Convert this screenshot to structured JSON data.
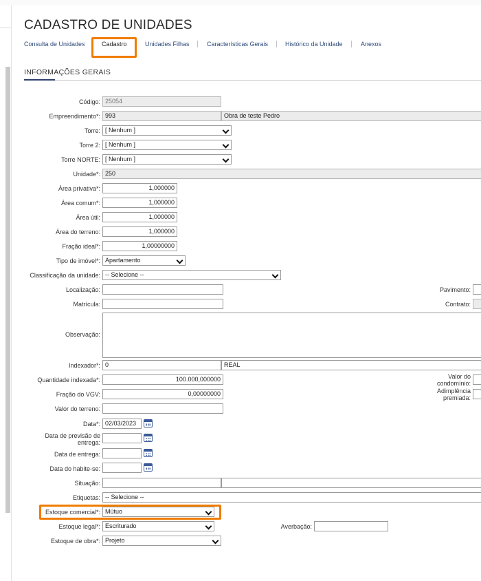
{
  "page": {
    "title": "CADASTRO DE UNIDADES"
  },
  "tabs": [
    {
      "label": "Consulta de Unidades"
    },
    {
      "label": "Cadastro"
    },
    {
      "label": "Unidades Filhas"
    },
    {
      "label": "Características Gerais"
    },
    {
      "label": "Histórico da Unidade"
    },
    {
      "label": "Anexos"
    }
  ],
  "section": {
    "title": "INFORMAÇÕES GERAIS"
  },
  "form": {
    "codigo": {
      "label": "Código:",
      "value": "25054"
    },
    "empreendimento": {
      "label": "Empreendimento*:",
      "code": "993",
      "name": "Obra de teste Pedro"
    },
    "torre": {
      "label": "Torre:",
      "value": "[ Nenhum ]"
    },
    "torre2": {
      "label": "Torre 2:",
      "value": "[ Nenhum ]"
    },
    "torre_norte": {
      "label": "Torre NORTE:",
      "value": "[ Nenhum ]"
    },
    "unidade": {
      "label": "Unidade*:",
      "value": "250"
    },
    "area_privativa": {
      "label": "Área privativa*:",
      "value": "1,000000"
    },
    "area_comum": {
      "label": "Área comum*:",
      "value": "1,000000"
    },
    "area_util": {
      "label": "Área útil:",
      "value": "1,000000"
    },
    "area_terreno": {
      "label": "Área do terreno:",
      "value": "1,000000"
    },
    "fracao_ideal": {
      "label": "Fração ideal*:",
      "value": "1,00000000"
    },
    "tipo_imovel": {
      "label": "Tipo de imóvel*:",
      "value": "Apartamento"
    },
    "classificacao": {
      "label": "Classificação da unidade:",
      "value": "-- Selecione --"
    },
    "localizacao": {
      "label": "Localização:",
      "value": ""
    },
    "pavimento": {
      "label": "Pavimento:",
      "value": ""
    },
    "matricula": {
      "label": "Matrícula:",
      "value": ""
    },
    "contrato": {
      "label": "Contrato:",
      "value": ""
    },
    "observacao": {
      "label": "Observação:",
      "value": ""
    },
    "indexador": {
      "label": "Indexador*:",
      "code": "0",
      "name": "REAL"
    },
    "quantidade_indexada": {
      "label": "Quantidade indexada*:",
      "value": "100.000,000000"
    },
    "valor_condominio": {
      "label_line1": "Valor do",
      "label_line2": "condomínio:",
      "value": ""
    },
    "fracao_vgv": {
      "label": "Fração do VGV:",
      "value": "0,00000000"
    },
    "adimplencia": {
      "label_line1": "Adimplência",
      "label_line2": "premiada:",
      "value": ""
    },
    "valor_terreno": {
      "label": "Valor do terreno:",
      "value": ""
    },
    "data": {
      "label": "Data*:",
      "value": "02/03/2023"
    },
    "data_previsao": {
      "label_line1": "Data de previsão de",
      "label_line2": "entrega:",
      "value": ""
    },
    "data_entrega": {
      "label": "Data de entrega:",
      "value": ""
    },
    "data_habite": {
      "label": "Data do habite-se:",
      "value": ""
    },
    "situacao": {
      "label": "Situação:",
      "value": ""
    },
    "etiquetas": {
      "label": "Etiquetas:",
      "value": "-- Selecione --"
    },
    "estoque_comercial": {
      "label": "Estoque comercial*:",
      "value": "Mútuo"
    },
    "estoque_legal": {
      "label": "Estoque legal*:",
      "value": "Escriturado"
    },
    "averbacao": {
      "label": "Averbação:",
      "value": ""
    },
    "estoque_obra": {
      "label": "Estoque de obra*:",
      "value": "Projeto"
    }
  },
  "icons": {
    "calendar": "calendar-icon",
    "dropdown": "chevron-down-icon"
  },
  "colors": {
    "highlight": "#f07c00",
    "tab_link": "#2f4b7c",
    "accent": "#2e3f6e"
  }
}
